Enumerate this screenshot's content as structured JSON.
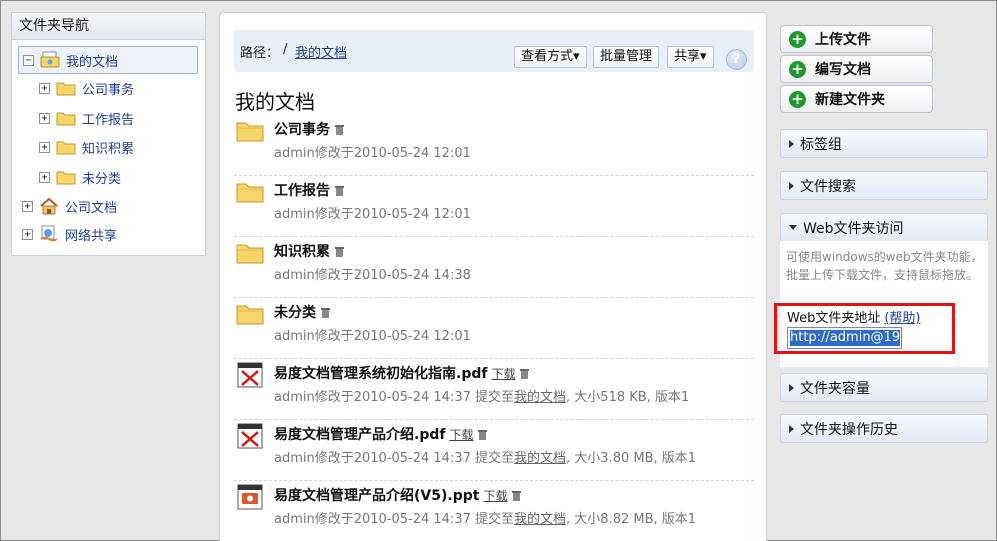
{
  "tree": {
    "title": "文件夹导航",
    "items": [
      {
        "label": "我的文档",
        "expander": "−",
        "icon": "my-documents-icon"
      },
      {
        "label": "公司事务",
        "expander": "+",
        "icon": "folder-icon"
      },
      {
        "label": "工作报告",
        "expander": "+",
        "icon": "folder-icon"
      },
      {
        "label": "知识积累",
        "expander": "+",
        "icon": "folder-icon"
      },
      {
        "label": "未分类",
        "expander": "+",
        "icon": "folder-icon"
      },
      {
        "label": "公司文档",
        "expander": "+",
        "icon": "company-home-icon"
      },
      {
        "label": "网络共享",
        "expander": "+",
        "icon": "network-share-icon"
      }
    ]
  },
  "main": {
    "path_label": "路径：",
    "path_sep": "/",
    "path_link": "我的文档",
    "toolbar": {
      "view_mode": "查看方式▾",
      "batch": "批量管理",
      "share": "共享▾",
      "help": "?"
    },
    "title": "我的文档",
    "items": [
      {
        "type": "folder",
        "name": "公司事务",
        "meta": "admin修改于2010-05-24 12:01"
      },
      {
        "type": "folder",
        "name": "工作报告",
        "meta": "admin修改于2010-05-24 12:01"
      },
      {
        "type": "folder",
        "name": "知识积累",
        "meta": "admin修改于2010-05-24 14:38"
      },
      {
        "type": "folder",
        "name": "未分类",
        "meta": "admin修改于2010-05-24 12:01"
      },
      {
        "type": "pdf",
        "name": "易度文档管理系统初始化指南.pdf",
        "download": "下载",
        "meta_a": "admin修改于2010-05-24 14:37 提交至",
        "meta_link": "我的文档",
        "meta_b": ", 大小518 KB, 版本1"
      },
      {
        "type": "pdf",
        "name": "易度文档管理产品介绍.pdf",
        "download": "下载",
        "meta_a": "admin修改于2010-05-24 14:37 提交至",
        "meta_link": "我的文档",
        "meta_b": ", 大小3.80 MB, 版本1"
      },
      {
        "type": "ppt",
        "name": "易度文档管理产品介绍(V5).ppt",
        "download": "下载",
        "meta_a": "admin修改于2010-05-24 14:37 提交至",
        "meta_link": "我的文档",
        "meta_b": ", 大小8.82 MB, 版本1"
      }
    ]
  },
  "side": {
    "actions": [
      "上传文件",
      "编写文档",
      "新建文件夹"
    ],
    "panels": {
      "tags": "标签组",
      "search": "文件搜索",
      "webdav": "Web文件夹访问",
      "quota": "文件夹容量",
      "history": "文件夹操作历史"
    },
    "webdav": {
      "description": "可使用windows的web文件夹功能，批量上传下载文件，支持鼠标拖放。",
      "address_label": "Web文件夹地址",
      "help_link": "(帮助)",
      "address_value": "http://admin@19"
    }
  },
  "colors": {
    "link": "#1f3d9a",
    "accent_green": "#1f9a2a",
    "highlight_red": "#e01414",
    "selection_blue": "#2d6bc7"
  }
}
